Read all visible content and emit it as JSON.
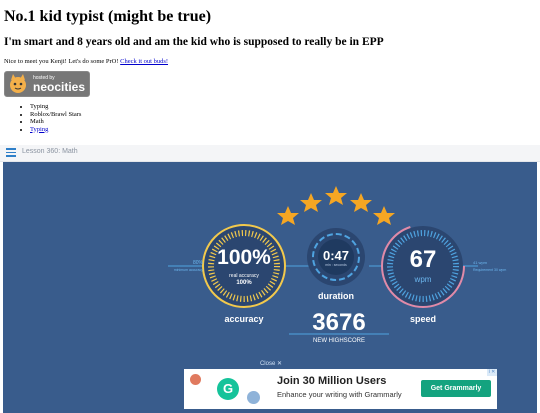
{
  "page": {
    "title": "No.1 kid typist (might be true)",
    "subtitle": "I'm smart and 8 years old and am the kid who is supposed to really be in EPP",
    "intro_text": "Nice to meet you Kenji! Let's do some PrO! ",
    "intro_link": "Check it out buds!"
  },
  "badge": {
    "small_text": "hosted by",
    "big_text": "neocities"
  },
  "links": [
    {
      "label": "Typing",
      "is_link": false
    },
    {
      "label": "Roblox/Brawl Stars",
      "is_link": false
    },
    {
      "label": "Math",
      "is_link": false
    },
    {
      "label": "Typing",
      "is_link": true
    }
  ],
  "typing_bar": {
    "lesson": "Lesson 360: Math"
  },
  "results": {
    "stars_filled": 5,
    "stars_total": 5,
    "accuracy_value": "100%",
    "accuracy_sub1": "real accuracy",
    "accuracy_sub2": "100%",
    "accuracy_label": "accuracy",
    "accuracy_goal": "80%",
    "accuracy_goal_caption": "minimum accuracy",
    "duration_value": "0:47",
    "duration_sub": "min : seconds",
    "duration_label": "duration",
    "speed_value": "67",
    "speed_unit": "wpm",
    "speed_label": "speed",
    "speed_goal": "41 wpm",
    "speed_goal_caption": "Requirement 30 wpm",
    "score": "3676",
    "score_caption": "NEW HIGHSCORE",
    "close_label": "Close ✕"
  },
  "ad": {
    "headline": "Join 30 Million Users",
    "subtext": "Enhance your writing with Grammarly",
    "cta": "Get Grammarly",
    "logo_letter": "G",
    "info_label": "i ✕"
  },
  "colors": {
    "stage_bg": "#395c8c",
    "gold": "#f2c94c",
    "ring_dark": "#2b4670",
    "accent_blue": "#4fa3e0",
    "speed_pink": "#e08aa8",
    "link_blue": "#0000cc",
    "ad_green": "#14a37f"
  },
  "icons": [
    "menu-icon",
    "neocities-cat-icon",
    "star-icon",
    "grammarly-logo-icon",
    "ad-info-icon"
  ]
}
